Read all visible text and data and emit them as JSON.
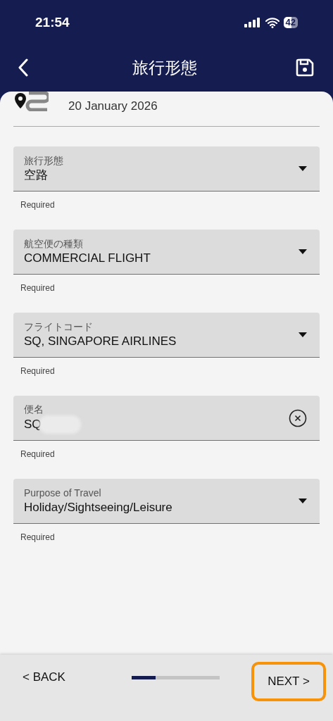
{
  "status_bar": {
    "time": "21:54",
    "battery": "42"
  },
  "header": {
    "title": "旅行形態"
  },
  "trip": {
    "date": "20 January 2026"
  },
  "fields": [
    {
      "kind": "dropdown",
      "label": "旅行形態",
      "value": "空路",
      "helper": "Required"
    },
    {
      "kind": "dropdown",
      "label": "航空便の種類",
      "value": "COMMERCIAL FLIGHT",
      "helper": "Required"
    },
    {
      "kind": "dropdown",
      "label": "フライトコード",
      "value": "SQ, SINGAPORE AIRLINES",
      "helper": "Required"
    },
    {
      "kind": "clearable",
      "label": "便名",
      "value": "SQ",
      "redacted": true,
      "helper": "Required"
    },
    {
      "kind": "dropdown",
      "label": "Purpose of Travel",
      "value": "Holiday/Sightseeing/Leisure",
      "helper": "Required"
    }
  ],
  "footer": {
    "back": "< BACK",
    "next": "NEXT >",
    "next_highlighted": true,
    "progress": {
      "level": 0.27
    }
  }
}
